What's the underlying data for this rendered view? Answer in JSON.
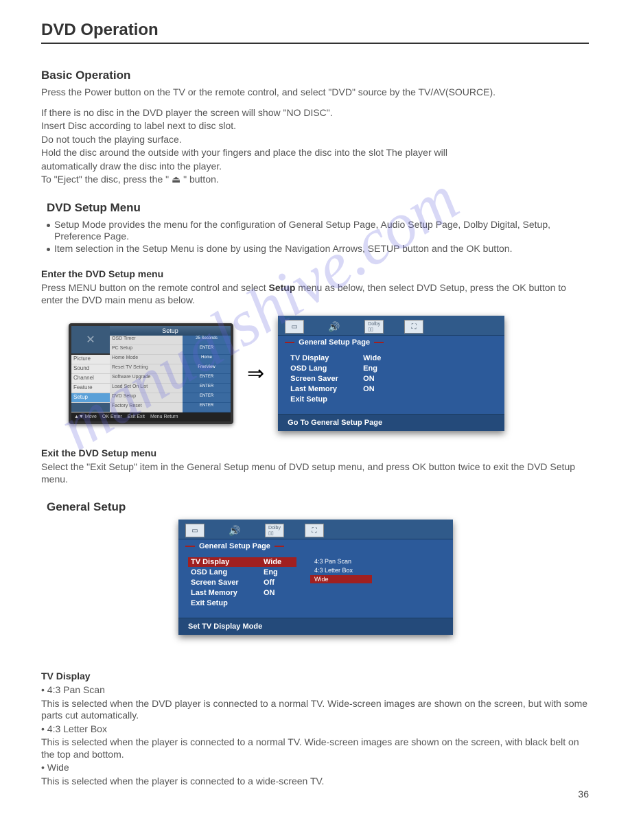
{
  "title": "DVD Operation",
  "page_number": "36",
  "watermark": "manualshive.com",
  "basic": {
    "heading": "Basic Operation",
    "lines": [
      "Press the Power button on the TV or the remote control, and select \"DVD\" source by the TV/AV(SOURCE).",
      "If there is no disc in the DVD player the screen will show \"NO DISC\".",
      "Insert Disc according to label next to disc slot.",
      "Do not touch the playing surface.",
      "Hold the disc around the outside with your fingers and place the disc into the slot  The player will",
      "automatically draw the disc into the player.",
      "To \"Eject\" the disc, press the  \" ⏏ \"  button."
    ]
  },
  "dvd_setup": {
    "heading": "DVD Setup Menu",
    "bullets": [
      "Setup Mode provides the menu for the configuration of General Setup Page, Audio Setup Page, Dolby Digital, Setup, Preference Page.",
      "Item selection in the Setup Menu is done by using the Navigation Arrows, SETUP button and the OK button."
    ],
    "enter_heading": "Enter the DVD Setup menu",
    "enter_text_1": "Press MENU button on the remote control and select ",
    "enter_bold": "Setup",
    "enter_text_2": " menu as below, then select DVD Setup, press the OK button to enter the DVD main menu as below.",
    "exit_heading": "Exit the DVD Setup menu",
    "exit_text": "Select the \"Exit Setup\" item in the General Setup menu of DVD setup menu, and press OK button twice to exit the DVD Setup menu."
  },
  "tv_menu": {
    "topbar": "Setup",
    "left_items": [
      "Picture",
      "Sound",
      "Channel",
      "Feature",
      "Setup"
    ],
    "left_selected": 4,
    "mid_items": [
      "OSD Timer",
      "PC Setup",
      "Home Mode",
      "Reset TV Setting",
      "Software Upgrade",
      "Load Set On List",
      "DVD Setup",
      "Factory Reset"
    ],
    "right_items": [
      "25 Seconds",
      "ENTER",
      "Home",
      "FreeView",
      "ENTER",
      "ENTER",
      "ENTER",
      "ENTER"
    ],
    "footer": [
      "▲▼  Move",
      "OK  Enter",
      "Exit  Exit",
      "Menu  Return"
    ]
  },
  "panel1": {
    "header": "General Setup Page",
    "rows": [
      {
        "lab": "TV Display",
        "val": "Wide"
      },
      {
        "lab": "OSD Lang",
        "val": "Eng"
      },
      {
        "lab": "Screen Saver",
        "val": "ON"
      },
      {
        "lab": "Last Memory",
        "val": "ON"
      },
      {
        "lab": "Exit Setup",
        "val": ""
      }
    ],
    "footer": "Go To General Setup Page"
  },
  "general": {
    "heading": "General Setup"
  },
  "panel2": {
    "header": "General Setup Page",
    "rows": [
      {
        "lab": "TV Display",
        "val": "Wide",
        "sel": true
      },
      {
        "lab": "OSD Lang",
        "val": "Eng"
      },
      {
        "lab": "Screen Saver",
        "val": "Off"
      },
      {
        "lab": "Last Memory",
        "val": "ON"
      },
      {
        "lab": "Exit Setup",
        "val": ""
      }
    ],
    "sub": [
      "4:3 Pan Scan",
      "4:3 Letter Box",
      "Wide"
    ],
    "sub_selected": 2,
    "footer": "Set TV Display Mode"
  },
  "tvdisplay": {
    "heading": "TV Display",
    "opts": [
      {
        "name": "• 4:3 Pan Scan",
        "desc": "This is selected when the DVD player is connected to a normal TV. Wide-screen images are shown on the screen, but with some parts cut automatically."
      },
      {
        "name": "• 4:3 Letter Box",
        "desc": "This is selected when the player is connected to a normal TV. Wide-screen images are shown on the screen, with black belt on the top and bottom."
      },
      {
        "name": "• Wide",
        "desc": "This is selected when the player is connected to a wide-screen TV."
      }
    ]
  }
}
